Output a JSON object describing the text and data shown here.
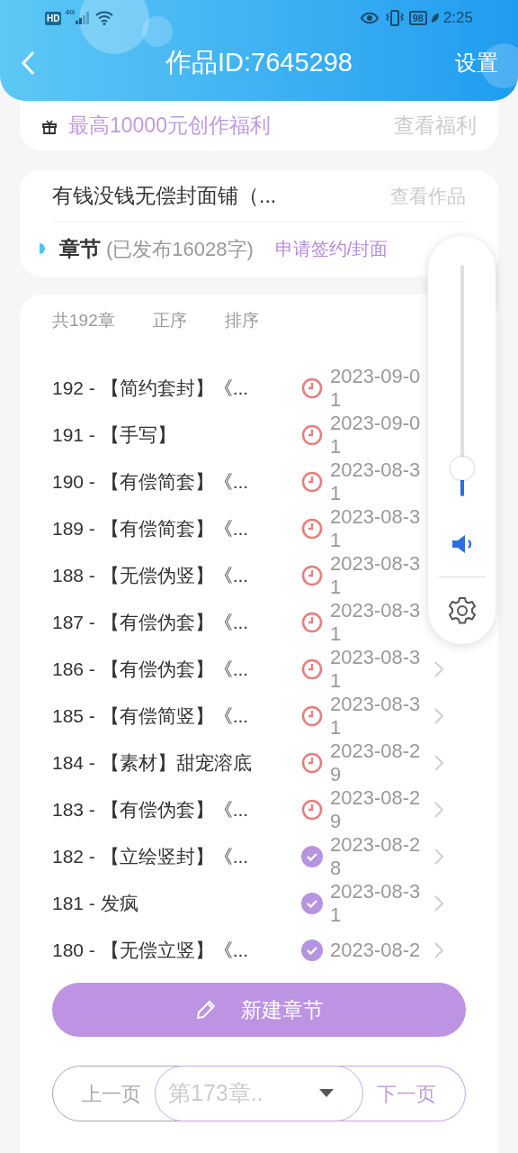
{
  "status_bar": {
    "hd": "HD",
    "network": "4G",
    "time": "2:25",
    "battery": "98"
  },
  "header": {
    "title": "作品ID:7645298",
    "action": "设置"
  },
  "benefit": {
    "text": "最高10000元创作福利",
    "link": "查看福利"
  },
  "work": {
    "title": "有钱没钱无偿封面铺（...",
    "link": "查看作品",
    "section": "章节",
    "published": "(已发布16028字)",
    "apply": "申请签约/封面"
  },
  "list_header": {
    "count": "共192章",
    "order": "正序",
    "sort": "排序"
  },
  "chapters": [
    {
      "title": "192 - 【简约套封】《...",
      "kind": "scheduled",
      "date": "2023-09-01"
    },
    {
      "title": "191 - 【手写】",
      "kind": "scheduled",
      "date": "2023-09-01"
    },
    {
      "title": "190 - 【有偿简套】《...",
      "kind": "scheduled",
      "date": "2023-08-31"
    },
    {
      "title": "189 - 【有偿简套】《...",
      "kind": "scheduled",
      "date": "2023-08-31"
    },
    {
      "title": "188 - 【无偿伪竖】《...",
      "kind": "scheduled",
      "date": "2023-08-31"
    },
    {
      "title": "187 - 【有偿伪套】《...",
      "kind": "scheduled",
      "date": "2023-08-31"
    },
    {
      "title": "186 - 【有偿伪套】《...",
      "kind": "scheduled",
      "date": "2023-08-31"
    },
    {
      "title": "185 - 【有偿简竖】《...",
      "kind": "scheduled",
      "date": "2023-08-31"
    },
    {
      "title": "184 - 【素材】甜宠溶底",
      "kind": "scheduled",
      "date": "2023-08-29"
    },
    {
      "title": "183 - 【有偿伪套】《...",
      "kind": "scheduled",
      "date": "2023-08-29"
    },
    {
      "title": "182 - 【立绘竖封】《...",
      "kind": "published",
      "date": "2023-08-28"
    },
    {
      "title": "181 - 发疯",
      "kind": "published",
      "date": "2023-08-31"
    },
    {
      "title": "180 - 【无偿立竖】《...",
      "kind": "published",
      "date": "2023-08-2"
    }
  ],
  "new_chapter_button": "新建章节",
  "pagination": {
    "prev": "上一页",
    "current": "第173章..",
    "next": "下一页"
  },
  "volume": {
    "level": 0.12
  }
}
